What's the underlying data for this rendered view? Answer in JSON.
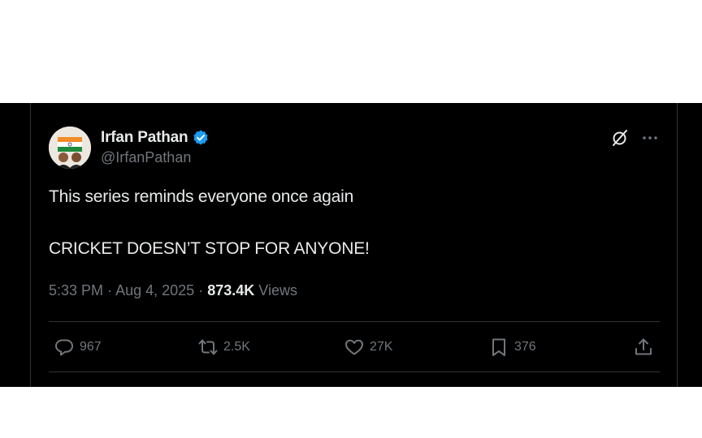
{
  "tweet": {
    "author": {
      "display_name": "Irfan Pathan",
      "handle": "@IrfanPathan",
      "verified": true
    },
    "text_line_1": "This series reminds everyone once again",
    "text_line_2": "CRICKET DOESN’T STOP FOR ANYONE!",
    "time": "5:33 PM",
    "separator_1": "·",
    "date": "Aug 4, 2025",
    "separator_2": "·",
    "views_count": "873.4K",
    "views_label": "Views"
  },
  "actions": {
    "replies": "967",
    "reposts": "2.5K",
    "likes": "27K",
    "bookmarks": "376"
  },
  "icons": {
    "verified": "verified-badge-icon",
    "grok": "grok-icon",
    "more": "more-icon",
    "reply": "reply-icon",
    "repost": "repost-icon",
    "like": "heart-icon",
    "bookmark": "bookmark-icon",
    "share": "share-icon"
  },
  "colors": {
    "background": "#000000",
    "primary_text": "#e7e9ea",
    "secondary_text": "#71767b",
    "verified_blue": "#1d9bf0",
    "divider": "#2f3336"
  }
}
